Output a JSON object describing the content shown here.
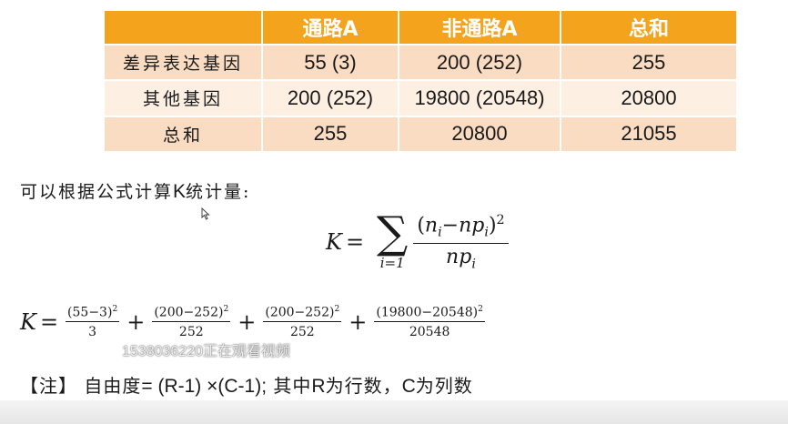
{
  "table": {
    "headers": [
      "",
      "通路A",
      "非通路A",
      "总和"
    ],
    "rows": [
      [
        "差异表达基因",
        "55 (3)",
        "200 (252)",
        "255"
      ],
      [
        "其他基因",
        "200 (252)",
        "19800 (20548)",
        "20800"
      ],
      [
        "总和",
        "255",
        "20800",
        "21055"
      ]
    ]
  },
  "intro": {
    "prefix": "可以根据公式计算",
    "k": "K",
    "suffix": "统计量:"
  },
  "formula1": {
    "lhs": "K",
    "eq": "=",
    "sum_lower": "i=1",
    "num_open": "(",
    "n": "n",
    "i": "i",
    "minus": "−",
    "np": "np",
    "num_close": ")",
    "pow": "2",
    "den_np": "np"
  },
  "formula2": {
    "lhs": "K",
    "eq": "=",
    "terms": [
      {
        "num": "(55−3)",
        "pow": "2",
        "den": "3"
      },
      {
        "num": "(200−252)",
        "pow": "2",
        "den": "252"
      },
      {
        "num": "(200−252)",
        "pow": "2",
        "den": "252"
      },
      {
        "num": "(19800−20548)",
        "pow": "2",
        "den": "20548"
      }
    ],
    "plus": "+"
  },
  "watermark": "1538036220正在观看视频",
  "note": {
    "bracket": "【注】",
    "label": "自由度",
    "expr": "= (R-1) ×(C-1);",
    "rest1": " 其中",
    "R": "R",
    "rest2": "为行数，",
    "C": "C",
    "rest3": "为列数"
  },
  "colors": {
    "header_orange": "#f3a41c",
    "row_dark": "#f9dcc2",
    "row_light": "#fdf0e3"
  }
}
